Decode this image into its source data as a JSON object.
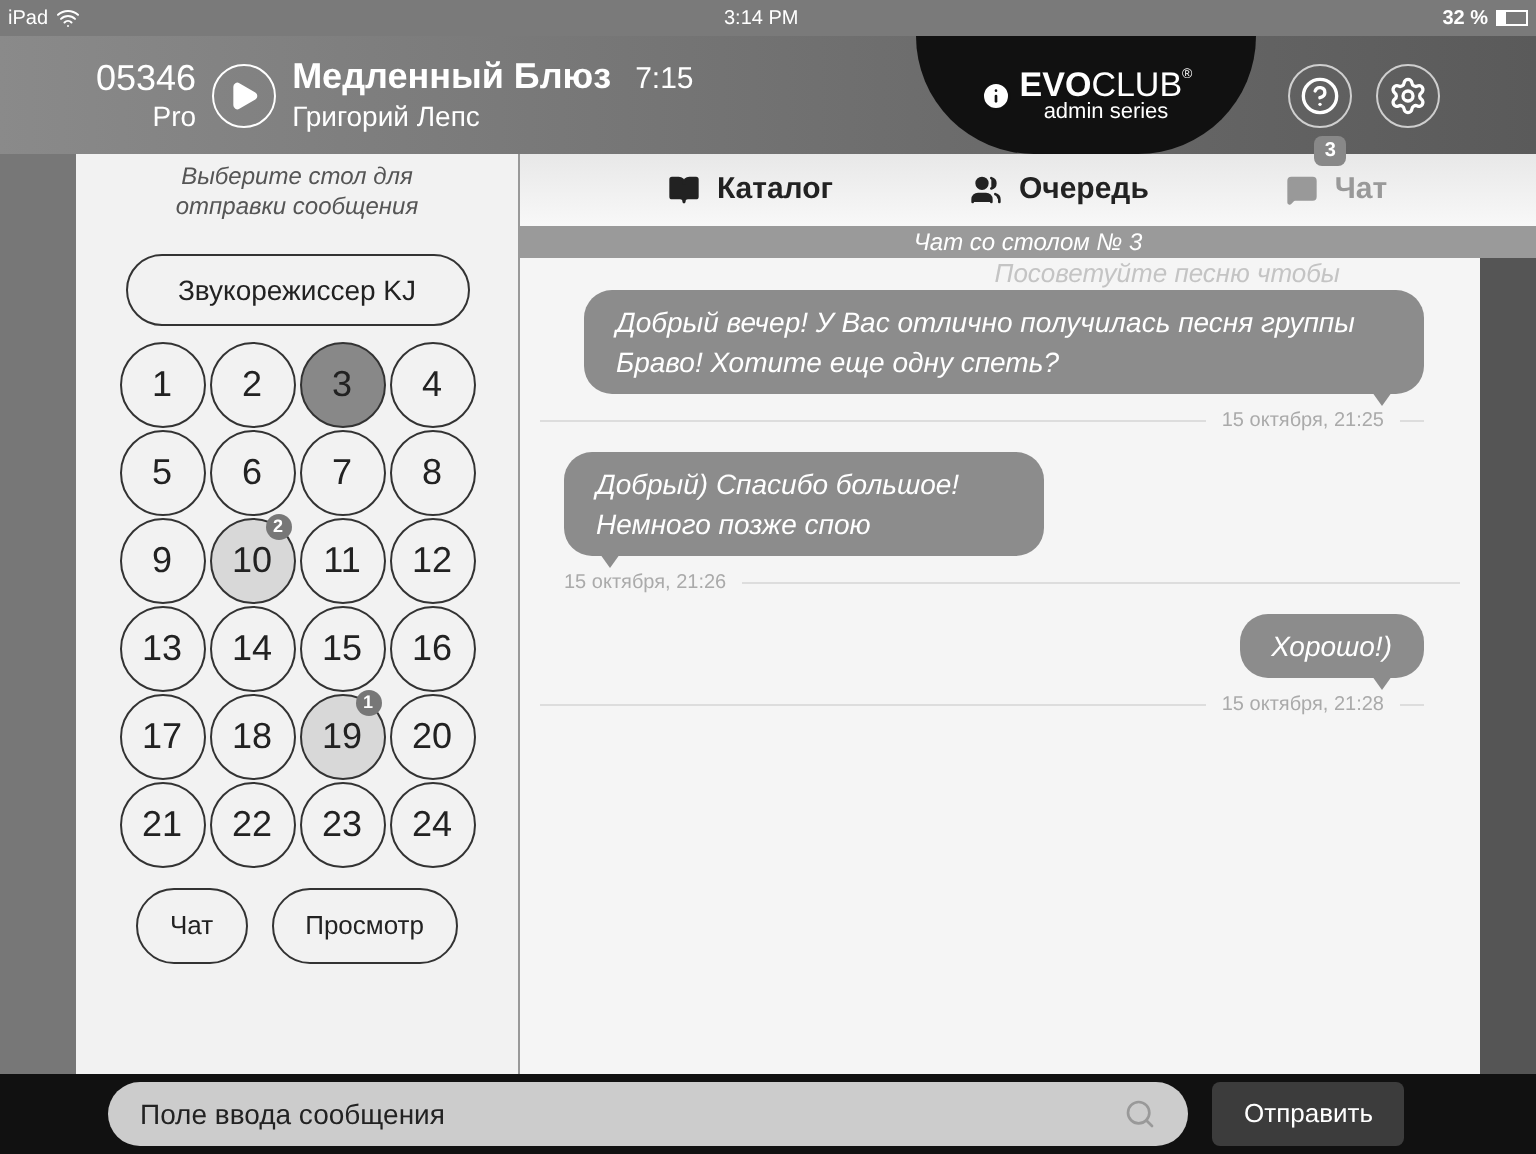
{
  "status_bar": {
    "device": "iPad",
    "time": "3:14 PM",
    "battery": "32 %"
  },
  "now_playing": {
    "code": "05346",
    "tier": "Pro",
    "title": "Медленный Блюз",
    "duration": "7:15",
    "artist": "Григорий Лепс"
  },
  "brand": {
    "name_bold": "EVO",
    "name_light": "CLUB",
    "trademark": "®",
    "subtitle": "admin series"
  },
  "sidebar": {
    "hint": "Выберите стол для отправки сообщения",
    "engineer_button": "Звукорежиссер KJ",
    "tables": [
      {
        "number": "1",
        "selected": false,
        "unread": false
      },
      {
        "number": "2",
        "selected": false,
        "unread": false
      },
      {
        "number": "3",
        "selected": true,
        "unread": false
      },
      {
        "number": "4",
        "selected": false,
        "unread": false
      },
      {
        "number": "5",
        "selected": false,
        "unread": false
      },
      {
        "number": "6",
        "selected": false,
        "unread": false
      },
      {
        "number": "7",
        "selected": false,
        "unread": false
      },
      {
        "number": "8",
        "selected": false,
        "unread": false
      },
      {
        "number": "9",
        "selected": false,
        "unread": false
      },
      {
        "number": "10",
        "selected": false,
        "unread": true,
        "badge": "2"
      },
      {
        "number": "11",
        "selected": false,
        "unread": false
      },
      {
        "number": "12",
        "selected": false,
        "unread": false
      },
      {
        "number": "13",
        "selected": false,
        "unread": false
      },
      {
        "number": "14",
        "selected": false,
        "unread": false
      },
      {
        "number": "15",
        "selected": false,
        "unread": false
      },
      {
        "number": "16",
        "selected": false,
        "unread": false
      },
      {
        "number": "17",
        "selected": false,
        "unread": false
      },
      {
        "number": "18",
        "selected": false,
        "unread": false
      },
      {
        "number": "19",
        "selected": false,
        "unread": true,
        "badge": "1"
      },
      {
        "number": "20",
        "selected": false,
        "unread": false
      },
      {
        "number": "21",
        "selected": false,
        "unread": false
      },
      {
        "number": "22",
        "selected": false,
        "unread": false
      },
      {
        "number": "23",
        "selected": false,
        "unread": false
      },
      {
        "number": "24",
        "selected": false,
        "unread": false
      }
    ],
    "buttons": [
      "Чат",
      "Просмотр"
    ]
  },
  "tabs": [
    {
      "label": "Каталог",
      "kind": "catalog",
      "selected": false
    },
    {
      "label": "Очередь",
      "kind": "queue",
      "selected": false
    },
    {
      "label": "Чат",
      "kind": "chat",
      "selected": true,
      "badge": "3"
    }
  ],
  "chat": {
    "title": "Чат со столом № 3",
    "faded_hint": "Посоветуйте песню чтобы",
    "messages": [
      {
        "kind": "out",
        "text": "Добрый вечер! У Вас отлично получилась песня группы Браво! Хотите еще одну спеть?",
        "time": "15 октября, 21:25"
      },
      {
        "kind": "in",
        "text": "Добрый) Спасибо большое! Немного позже спою",
        "time": "15 октября, 21:26"
      },
      {
        "kind": "out",
        "text": "Хорошо!)",
        "time": "15 октября, 21:28"
      }
    ]
  },
  "composer": {
    "placeholder": "Поле ввода сообщения",
    "send": "Отправить"
  }
}
